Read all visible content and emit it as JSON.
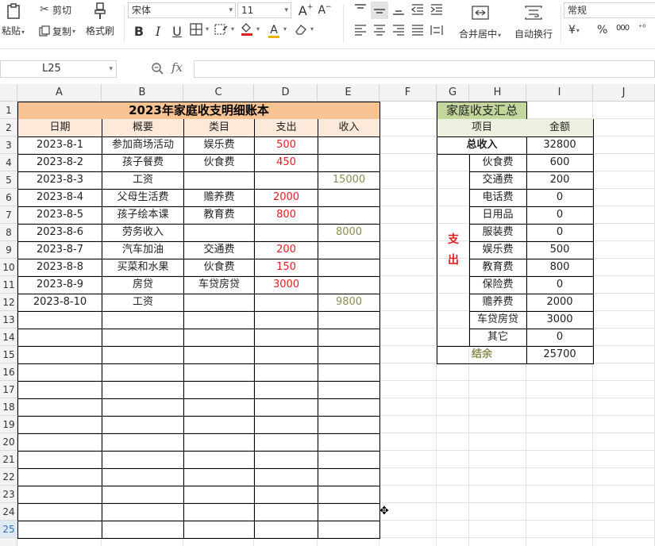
{
  "toolbar": {
    "paste_label": "粘贴",
    "cut_label": "剪切",
    "copy_label": "复制",
    "format_painter_label": "格式刷",
    "font_name": "宋体",
    "font_size": "11",
    "merge_center_label": "合并居中",
    "wrap_text_label": "自动换行",
    "number_format": "常规",
    "currency_symbol": "¥",
    "percent_symbol": "%",
    "thousands_symbol": "000",
    "grow_font_label": "A",
    "shrink_font_label": "A",
    "bold_label": "B",
    "italic_label": "I",
    "underline_label": "U",
    "font_color_label": "A",
    "accent_color": "#e02020"
  },
  "formula_bar": {
    "cell_reference": "L25",
    "fx_label": "fx",
    "formula_value": ""
  },
  "grid": {
    "columns": [
      "A",
      "B",
      "C",
      "D",
      "E",
      "F",
      "G",
      "H",
      "I",
      "J"
    ],
    "rows": [
      "1",
      "2",
      "3",
      "4",
      "5",
      "6",
      "7",
      "8",
      "9",
      "10",
      "11",
      "12",
      "13",
      "14",
      "15",
      "16",
      "17",
      "18",
      "19",
      "20",
      "21",
      "22",
      "23",
      "24",
      "25"
    ],
    "active_row": "25"
  },
  "ledger": {
    "title": "2023年家庭收支明细账本",
    "headers": [
      "日期",
      "概要",
      "类目",
      "支出",
      "收入"
    ],
    "rows": [
      {
        "date": "2023-8-1",
        "summary": "参加商场活动",
        "category": "娱乐费",
        "expense": "500",
        "income": ""
      },
      {
        "date": "2023-8-2",
        "summary": "孩子餐费",
        "category": "伙食费",
        "expense": "450",
        "income": ""
      },
      {
        "date": "2023-8-3",
        "summary": "工资",
        "category": "",
        "expense": "",
        "income": "15000"
      },
      {
        "date": "2023-8-4",
        "summary": "父母生活费",
        "category": "赡养费",
        "expense": "2000",
        "income": ""
      },
      {
        "date": "2023-8-5",
        "summary": "孩子绘本课",
        "category": "教育费",
        "expense": "800",
        "income": ""
      },
      {
        "date": "2023-8-6",
        "summary": "劳务收入",
        "category": "",
        "expense": "",
        "income": "8000"
      },
      {
        "date": "2023-8-7",
        "summary": "汽车加油",
        "category": "交通费",
        "expense": "200",
        "income": ""
      },
      {
        "date": "2023-8-8",
        "summary": "买菜和水果",
        "category": "伙食费",
        "expense": "150",
        "income": ""
      },
      {
        "date": "2023-8-9",
        "summary": "房贷",
        "category": "车贷房贷",
        "expense": "3000",
        "income": ""
      },
      {
        "date": "2023-8-10",
        "summary": "工资",
        "category": "",
        "expense": "",
        "income": "9800"
      }
    ]
  },
  "summary": {
    "title": "家庭收支汇总",
    "header_item": "项目",
    "header_amount": "金额",
    "total_income_label": "总收入",
    "total_income_value": "32800",
    "spend_label_1": "支",
    "spend_label_2": "出",
    "items": [
      {
        "name": "伙食费",
        "amount": "600"
      },
      {
        "name": "交通费",
        "amount": "200"
      },
      {
        "name": "电话费",
        "amount": "0"
      },
      {
        "name": "日用品",
        "amount": "0"
      },
      {
        "name": "服装费",
        "amount": "0"
      },
      {
        "name": "娱乐费",
        "amount": "500"
      },
      {
        "name": "教育费",
        "amount": "800"
      },
      {
        "name": "保险费",
        "amount": "0"
      },
      {
        "name": "赡养费",
        "amount": "2000"
      },
      {
        "name": "车贷房贷",
        "amount": "3000"
      },
      {
        "name": "其它",
        "amount": "0"
      }
    ],
    "balance_label": "结余",
    "balance_value": "25700"
  }
}
